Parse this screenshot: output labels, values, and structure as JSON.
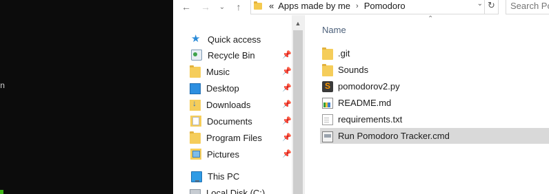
{
  "terminal": {
    "visible_text": "n"
  },
  "toolbar": {
    "back_icon": "arrow-left-icon",
    "forward_icon": "arrow-right-icon",
    "recent_icon": "chevron-down-icon",
    "up_icon": "arrow-up-icon",
    "overflow_label": "«",
    "breadcrumbs": [
      "Apps made by me",
      "Pomodoro"
    ],
    "breadcrumb_separator": "›",
    "search_placeholder": "Search Po"
  },
  "navigation": {
    "quick_access": "Quick access",
    "items": [
      {
        "label": "Recycle Bin",
        "icon": "recycle-bin-icon",
        "pinned": true
      },
      {
        "label": "Music",
        "icon": "folder-icon",
        "pinned": true
      },
      {
        "label": "Desktop",
        "icon": "desktop-icon",
        "pinned": true
      },
      {
        "label": "Downloads",
        "icon": "downloads-icon",
        "pinned": true
      },
      {
        "label": "Documents",
        "icon": "documents-icon",
        "pinned": true
      },
      {
        "label": "Program Files",
        "icon": "folder-icon",
        "pinned": true
      },
      {
        "label": "Pictures",
        "icon": "pictures-icon",
        "pinned": true
      }
    ],
    "this_pc": "This PC",
    "local_disk": "Local Disk (C:)"
  },
  "content": {
    "column_name": "Name",
    "files": [
      {
        "name": ".git",
        "icon": "folder-icon",
        "selected": false
      },
      {
        "name": "Sounds",
        "icon": "folder-icon",
        "selected": false
      },
      {
        "name": "pomodorov2.py",
        "icon": "sublime-file-icon",
        "selected": false
      },
      {
        "name": "README.md",
        "icon": "markdown-file-icon",
        "selected": false
      },
      {
        "name": "requirements.txt",
        "icon": "text-file-icon",
        "selected": false
      },
      {
        "name": "Run Pomodoro Tracker.cmd",
        "icon": "cmd-file-icon",
        "selected": true
      }
    ]
  },
  "colors": {
    "terminal_bg": "#0c0c0c",
    "selection": "#d9d9d9",
    "header_text": "#4c607a",
    "accent_blue": "#2b8bd8"
  }
}
